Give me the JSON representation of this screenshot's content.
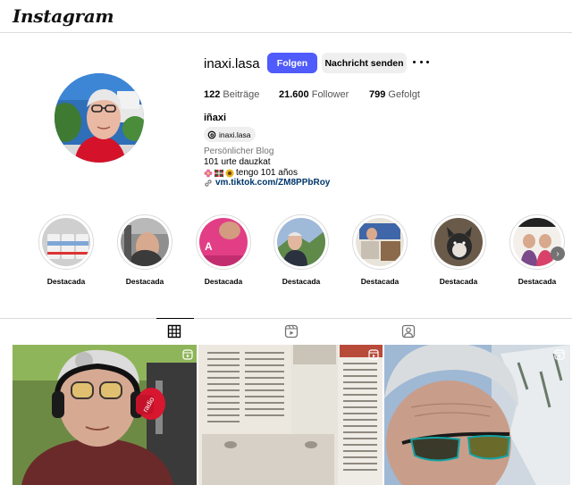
{
  "app": {
    "logo_text": "Instagram"
  },
  "profile": {
    "username": "inaxi.lasa",
    "follow_label": "Folgen",
    "message_label": "Nachricht senden",
    "stats": {
      "posts_count": "122",
      "posts_label": "Beiträge",
      "followers_count": "21.600",
      "followers_label": "Follower",
      "following_count": "799",
      "following_label": "Gefolgt"
    },
    "full_name": "iñaxi",
    "threads_handle": "inaxi.lasa",
    "category": "Persönlicher Blog",
    "bio_line1": "101 urte dauzkat",
    "bio_line2": "tengo 101 años",
    "link": "vm.tiktok.com/ZM8PPbRoy"
  },
  "highlights": [
    {
      "label": "Destacada"
    },
    {
      "label": "Destacada"
    },
    {
      "label": "Destacada"
    },
    {
      "label": "Destacada"
    },
    {
      "label": "Destacada"
    },
    {
      "label": "Destacada"
    },
    {
      "label": "Destacada"
    }
  ],
  "tabs": [
    {
      "icon": "grid-icon",
      "active": true
    },
    {
      "icon": "reels-icon",
      "active": false
    },
    {
      "icon": "tagged-icon",
      "active": false
    }
  ],
  "colors": {
    "primary_button": "#4f5bfa",
    "secondary_button": "#efefef",
    "link": "#00376b"
  }
}
